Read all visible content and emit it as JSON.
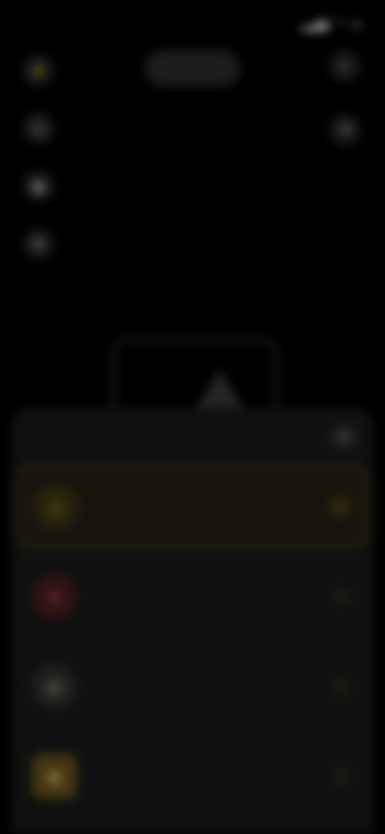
{
  "status_bar": {
    "time": "",
    "signal": "",
    "wifi": "",
    "battery": ""
  },
  "camera": {
    "mode_label": "",
    "left_controls": [
      "flash-icon",
      "timer-icon",
      "grid-icon",
      "settings-icon"
    ],
    "right_controls": [
      "filter-icon",
      "switch-camera-icon"
    ]
  },
  "sheet": {
    "title": "",
    "close_icon": "close-icon",
    "items": [
      {
        "title": "",
        "subtitle": "",
        "icon": "camera-icon",
        "selected": true
      },
      {
        "title": "",
        "subtitle": "",
        "icon": "video-icon",
        "selected": false
      },
      {
        "title": "",
        "subtitle": "",
        "icon": "portrait-icon",
        "selected": false
      },
      {
        "title": "",
        "subtitle": "",
        "icon": "document-icon",
        "selected": false
      }
    ]
  },
  "colors": {
    "accent": "#d4b03a",
    "sheet_bg": "#1e1e1e",
    "selected_border": "#6b5a1e"
  }
}
